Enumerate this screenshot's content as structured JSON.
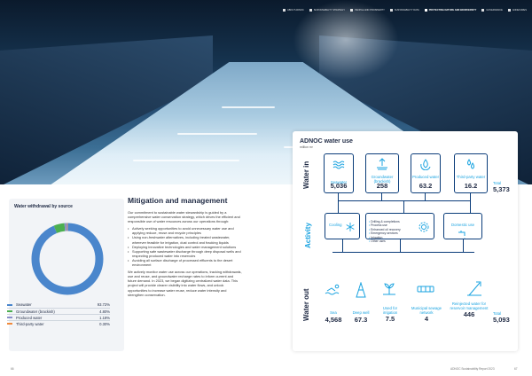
{
  "topnav": [
    "ABOUT ADNOC",
    "SUSTAINABILITY STRATEGY",
    "PEOPLE AND PROSPERITY",
    "SUSTAINABILITY DATA",
    "PROTECTING NATURE AND BIODIVERSITY",
    "GOVERNANCE",
    "ANNEXURES"
  ],
  "topnav_active_index": 4,
  "chart": {
    "title": "Water withdrawal by source",
    "chart_data": {
      "type": "pie",
      "categories": [
        "Seawater",
        "Groundwater (brackish)",
        "Produced water",
        "Third-party water"
      ],
      "values": [
        93.72,
        4.8,
        1.18,
        0.3
      ],
      "colors": [
        "#4a86cc",
        "#4caf50",
        "#8a8fc8",
        "#f08a3c"
      ]
    },
    "legend": [
      {
        "name": "Seawater",
        "value": "93.72%",
        "color": "#4a86cc"
      },
      {
        "name": "Groundwater (brackish)",
        "value": "4.80%",
        "color": "#4caf50"
      },
      {
        "name": "Produced water",
        "value": "1.18%",
        "color": "#8a8fc8"
      },
      {
        "name": "Third-party water",
        "value": "0.30%",
        "color": "#f08a3c"
      }
    ]
  },
  "article": {
    "title": "Mitigation and management",
    "intro": "Our commitment to sustainable water stewardship is guided by a comprehensive water conservation strategy, which drives the efficient and responsible use of water resources across our operations through:",
    "bullets": [
      "Actively seeking opportunities to avoid unnecessary water use and applying reduce, reuse and recycle principles",
      "Using non-freshwater alternatives, including treated wastewater, wherever feasible for irrigation, dust control and fracking liquids",
      "Deploying innovative technologies and water management solutions",
      "Supporting safe wastewater discharge through deep disposal wells and respecting produced water into reservoirs",
      "Avoiding all surface discharge of processed effluents to the desert environment"
    ],
    "closing": "We actively monitor water use across our operations, tracking withdrawals, use and reuse, and groundwater recharge rates to inform current and future demand. In 2023, we began digitizing centralized water data. This project will provide clearer visibility into water flows, and unlock opportunities to increase water reuse, reduce water intensity and strengthen conservation."
  },
  "water_use": {
    "title": "ADNOC water use",
    "unit": "million m³",
    "rows": {
      "in": "Water in",
      "activity": "Activity",
      "out": "Water out"
    },
    "water_in": [
      {
        "label": "Seawater",
        "value": "5,036",
        "icon": "waves-icon"
      },
      {
        "label": "Groundwater (brackish)",
        "value": "258",
        "icon": "groundwater-icon"
      },
      {
        "label": "Produced water",
        "value": "63.2",
        "icon": "droplet-recycle-icon"
      },
      {
        "label": "Third-party water",
        "value": "16.2",
        "icon": "droplets-icon"
      }
    ],
    "water_in_total": {
      "label": "Total",
      "value": "5,373"
    },
    "activity": {
      "cooling": "Cooling",
      "items": [
        "Drilling & completions",
        "Process use",
        "Enhanced oil recovery",
        "Emergency services",
        "Irrigation",
        "Other uses"
      ],
      "domestic": "Domestic use"
    },
    "water_out": [
      {
        "label": "Sea",
        "value": "4,568",
        "icon": "swimmer-icon"
      },
      {
        "label": "Deep well",
        "value": "67.3",
        "icon": "well-icon"
      },
      {
        "label": "Used for irrigation",
        "value": "7.5",
        "icon": "irrigation-icon"
      },
      {
        "label": "Municipal sewage network",
        "value": "4",
        "icon": "sewage-icon"
      },
      {
        "label": "Reinjected water for reservoir management",
        "value": "446",
        "icon": "reinjection-icon"
      }
    ],
    "water_out_total": {
      "label": "Total",
      "value": "5,093"
    }
  },
  "footer": {
    "left_page": "66",
    "right_label": "ADNOC Sustainability Report 2023",
    "right_page": "67"
  }
}
